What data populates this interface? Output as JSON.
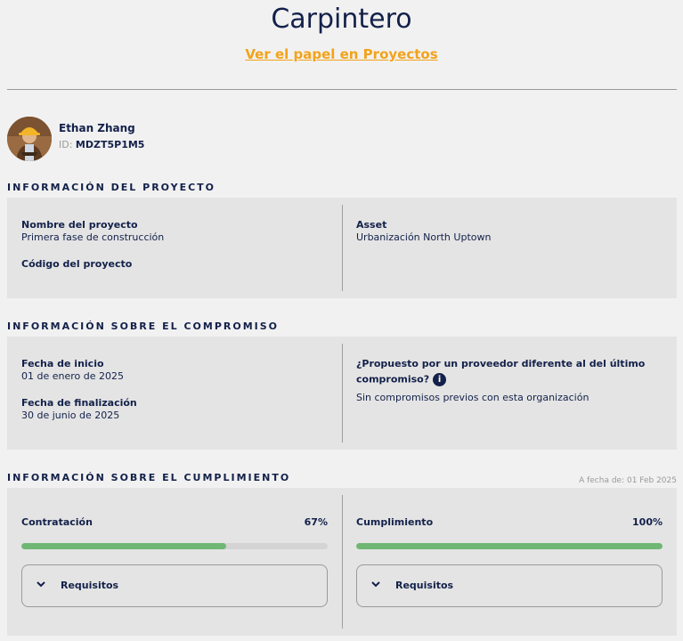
{
  "header": {
    "title": "Carpintero",
    "project_role_link": "Ver el papel en Proyectos"
  },
  "person": {
    "name": "Ethan Zhang",
    "id_label": "ID:",
    "id_value": "MDZT5P1M5"
  },
  "project_info": {
    "heading": "INFORMACIÓN DEL PROYECTO",
    "project_name_label": "Nombre del proyecto",
    "project_name_value": "Primera fase de construcción",
    "project_code_label": "Código del proyecto",
    "asset_label": "Asset",
    "asset_value": "Urbanización North Uptown"
  },
  "engagement_info": {
    "heading": "INFORMACIÓN SOBRE EL COMPROMISO",
    "start_date_label": "Fecha de inicio",
    "start_date_value": "01 de enero de 2025",
    "end_date_label": "Fecha de finalización",
    "end_date_value": "30 de junio de 2025",
    "different_provider_label_line1": "¿Propuesto por un proveedor diferente al del último",
    "different_provider_label_line2": "compromiso?",
    "different_provider_value": "Sin compromisos previos con esta organización"
  },
  "compliance_info": {
    "heading": "INFORMACIÓN SOBRE EL CUMPLIMIENTO",
    "as_of": "A fecha de: 01 Feb 2025",
    "hiring": {
      "label": "Contratación",
      "percent_text": "67%",
      "progress": 0.67,
      "requirements_label": "Requisitos"
    },
    "compliance": {
      "label": "Cumplimiento",
      "percent_text": "100%",
      "progress": 1.0,
      "requirements_label": "Requisitos"
    }
  },
  "colors": {
    "text": "#13214a",
    "link": "#f2a31b",
    "progress_fill": "#6fb774",
    "panel_bg": "#e4e4e4",
    "page_bg": "#f1f1f1"
  }
}
